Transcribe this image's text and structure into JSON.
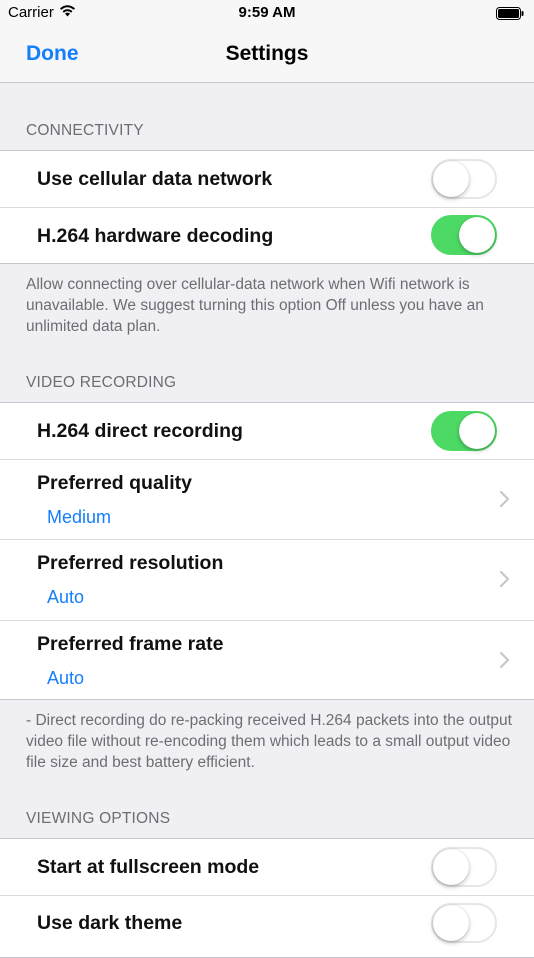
{
  "status_bar": {
    "carrier": "Carrier",
    "time": "9:59 AM"
  },
  "nav": {
    "done_label": "Done",
    "title": "Settings"
  },
  "colors": {
    "accent": "#147efb",
    "toggle_on": "#4cd964",
    "background": "#efeff4"
  },
  "connectivity": {
    "header": "CONNECTIVITY",
    "items": [
      {
        "label": "Use cellular data network",
        "enabled": false
      },
      {
        "label": "H.264 hardware decoding",
        "enabled": true
      }
    ],
    "footer": "Allow connecting over cellular-data network when Wifi network is unavailable. We suggest turning this option Off unless you have an unlimited data plan."
  },
  "video_recording": {
    "header": "VIDEO RECORDING",
    "direct_recording": {
      "label": "H.264 direct recording",
      "enabled": true
    },
    "items": [
      {
        "label": "Preferred quality",
        "value": "Medium"
      },
      {
        "label": "Preferred resolution",
        "value": "Auto"
      },
      {
        "label": "Preferred frame rate",
        "value": "Auto"
      }
    ],
    "footer": "- Direct recording do re-packing received H.264 packets into the output video file without re-encoding them which leads to a small output video file size and best battery efficient."
  },
  "viewing_options": {
    "header": "VIEWING OPTIONS",
    "items": [
      {
        "label": "Start at fullscreen mode",
        "enabled": false
      },
      {
        "label": "Use dark theme",
        "enabled": false
      }
    ]
  }
}
